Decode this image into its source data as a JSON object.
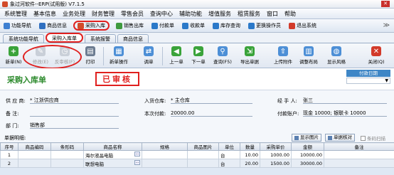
{
  "window": {
    "title": "象过河软件--ERP(试用版) V7.1.5",
    "close": "✕"
  },
  "menu": [
    "系统管理",
    "基本信息",
    "业务处理",
    "财务管理",
    "零售会员",
    "查询中心",
    "辅助功能",
    "增值服务",
    "租赁服务",
    "窗口",
    "帮助"
  ],
  "quickbar": {
    "items": [
      {
        "label": "功能导航",
        "icon": "home-icon",
        "color": "#3d7fd1"
      },
      {
        "label": "商品信息",
        "icon": "product-icon",
        "color": "#2f6fc0"
      },
      {
        "label": "采购入库",
        "icon": "purchase-in-icon",
        "color": "#d24b2a"
      },
      {
        "label": "销售出库",
        "icon": "sales-out-icon",
        "color": "#3e9a3e"
      },
      {
        "label": "付款单",
        "icon": "payment-icon",
        "color": "#2b79c9"
      },
      {
        "label": "收款单",
        "icon": "receipt-icon",
        "color": "#2b79c9"
      },
      {
        "label": "库存查询",
        "icon": "stock-query-icon",
        "color": "#2b79c9"
      },
      {
        "label": "更换操作员",
        "icon": "switch-user-icon",
        "color": "#2b79c9"
      },
      {
        "label": "退出系统",
        "icon": "exit-icon",
        "color": "#d23a2a"
      }
    ],
    "expand": "≫"
  },
  "tabs": [
    "系统功能导航",
    "采购入库单",
    "系统报警",
    "商品信息"
  ],
  "toolbar": {
    "new": "新单(N)",
    "edit": "修改(E)",
    "unaudit": "反审核(F)",
    "print": "打印",
    "new_op": "新单操作",
    "transfer": "调单",
    "prev": "上一单",
    "next": "下一单",
    "query": "查询(F5)",
    "export": "导出单据",
    "upload": "上传附件",
    "template": "调整布局",
    "style": "显示风格",
    "close": "关闭(Q)"
  },
  "doc": {
    "title": "采购入库单",
    "status": "已审核",
    "pay_date_label": "付款日期",
    "pay_date_value": ""
  },
  "form": {
    "supplier_label": "供 应 商:",
    "supplier_value": "* 江浙供应商",
    "remark_label": "备    注:",
    "remark_value": "",
    "dept_label": "部    门:",
    "dept_value": "销售部",
    "warehouse_label": "入货仓库:",
    "warehouse_value": "* 主仓库",
    "this_pay_label": "本次付款:",
    "this_pay_value": "20000.00",
    "handler_label": "经 手 人:",
    "handler_value": "张三",
    "pay_acct_label": "付款账户:",
    "pay_acct_value": "现金 10000; 银联卡 10000"
  },
  "detail": {
    "label": "单据明细:",
    "show_image": "显示图片",
    "line_check": "单据核对",
    "barcode": "条码扫描"
  },
  "grid": {
    "headers": [
      "序号",
      "商品编码",
      "条形码",
      "商品名称",
      "规格",
      "商品图片",
      "单位",
      "数量",
      "采购单价",
      "金额",
      "备注"
    ],
    "rows": [
      {
        "no": "1",
        "code": "",
        "barcode": "",
        "name": "海尔液晶电脑",
        "spec": "",
        "img": "",
        "unit": "台",
        "qty": "10.00",
        "price": "1000.00",
        "amount": "10000.00",
        "note": ""
      },
      {
        "no": "2",
        "code": "",
        "barcode": "",
        "name": "联想电脑",
        "spec": "",
        "img": "",
        "unit": "台",
        "qty": "20.00",
        "price": "1500.00",
        "amount": "30000.00",
        "note": ""
      }
    ]
  }
}
